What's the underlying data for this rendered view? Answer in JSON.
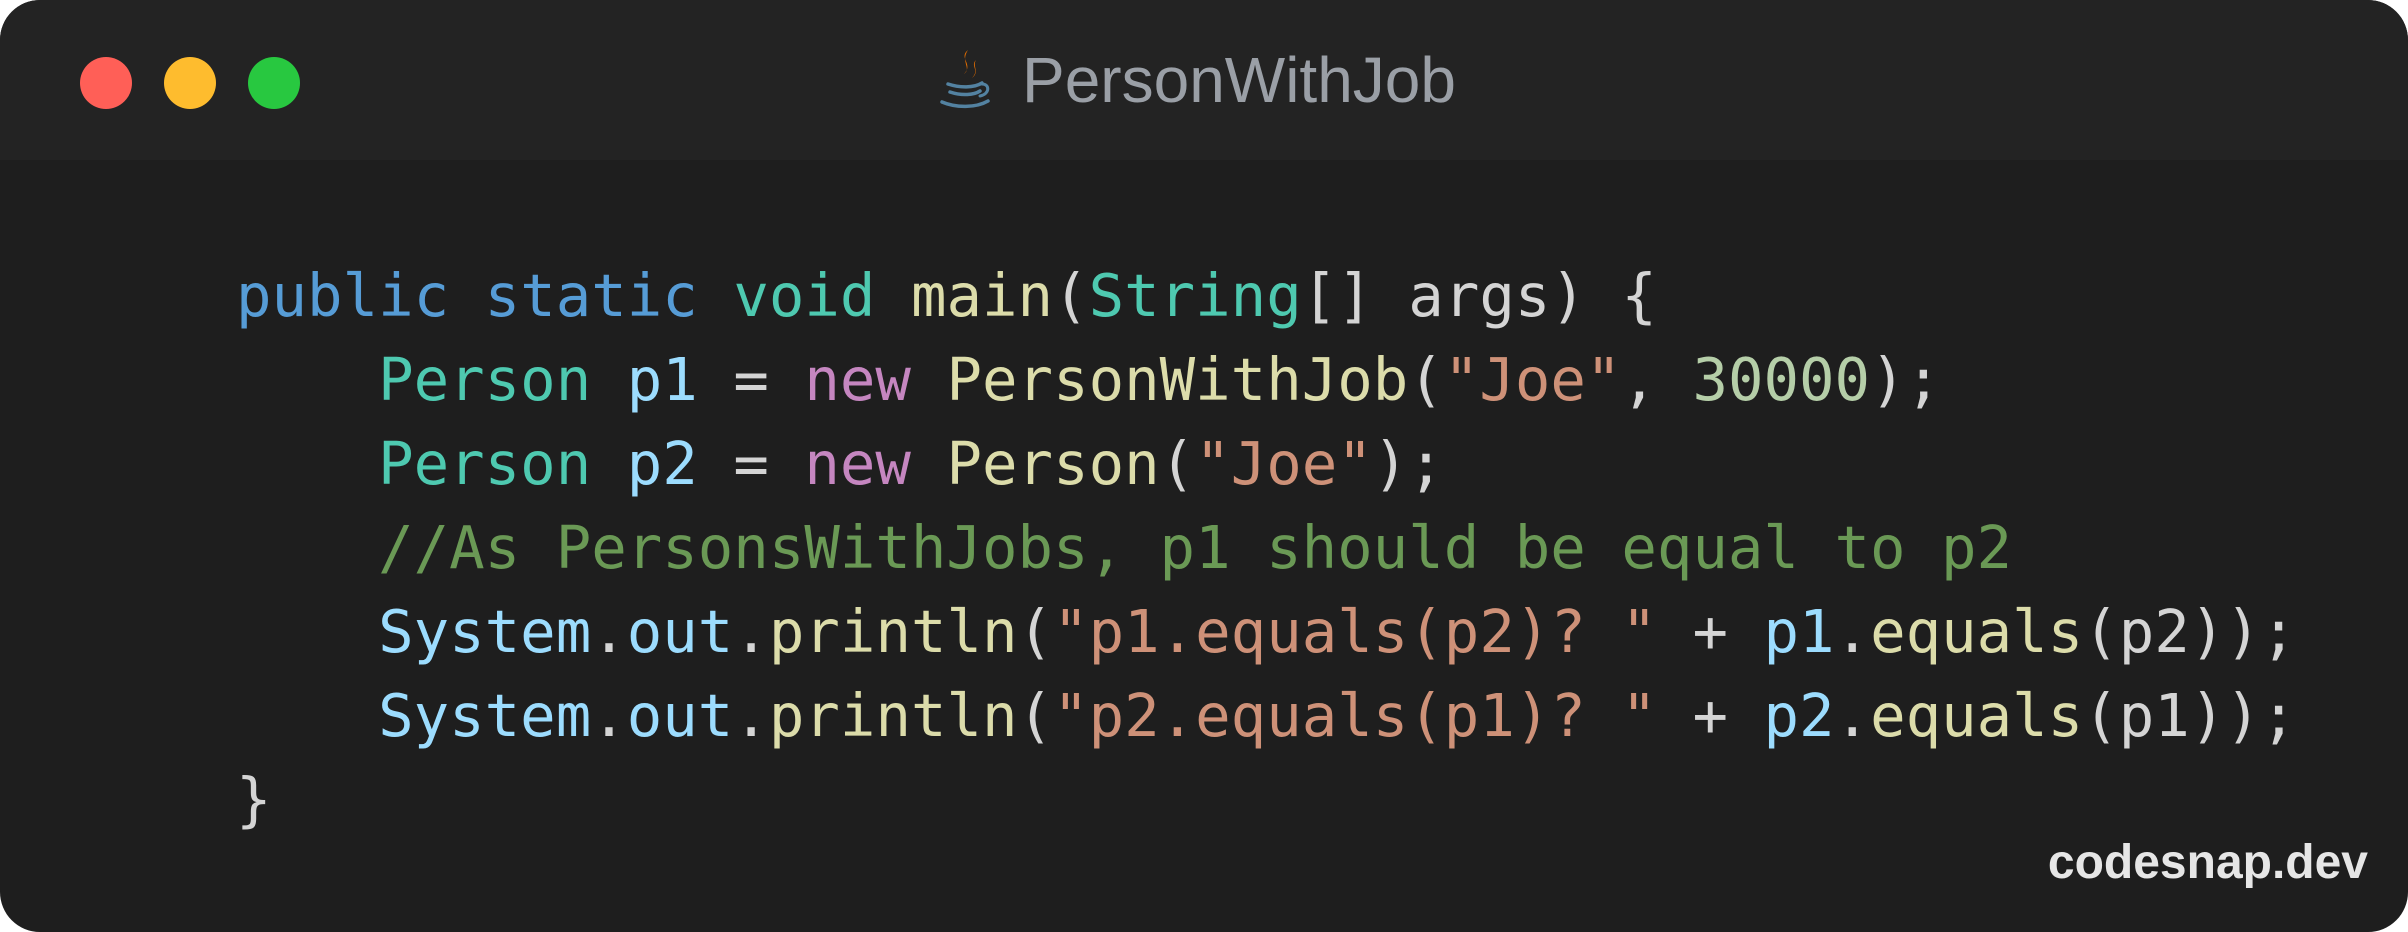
{
  "window": {
    "title": "PersonWithJob",
    "icon": "java-coffee-cup-icon",
    "controls": [
      {
        "name": "close-button",
        "color": "#ff5f57"
      },
      {
        "name": "minimize-button",
        "color": "#febc2e"
      },
      {
        "name": "zoom-button",
        "color": "#28c840"
      }
    ]
  },
  "code": {
    "language": "java",
    "lines": [
      [
        {
          "t": "public",
          "k": "keyword"
        },
        {
          "t": " ",
          "k": "plain"
        },
        {
          "t": "static",
          "k": "keyword"
        },
        {
          "t": " ",
          "k": "plain"
        },
        {
          "t": "void",
          "k": "type"
        },
        {
          "t": " ",
          "k": "plain"
        },
        {
          "t": "main",
          "k": "func"
        },
        {
          "t": "(",
          "k": "plain"
        },
        {
          "t": "String",
          "k": "type"
        },
        {
          "t": "[] args) {",
          "k": "plain"
        }
      ],
      [
        {
          "t": "    ",
          "k": "plain"
        },
        {
          "t": "Person",
          "k": "type"
        },
        {
          "t": " ",
          "k": "plain"
        },
        {
          "t": "p1",
          "k": "var"
        },
        {
          "t": " = ",
          "k": "plain"
        },
        {
          "t": "new",
          "k": "new"
        },
        {
          "t": " ",
          "k": "plain"
        },
        {
          "t": "PersonWithJob",
          "k": "func"
        },
        {
          "t": "(",
          "k": "plain"
        },
        {
          "t": "\"Joe\"",
          "k": "string"
        },
        {
          "t": ", ",
          "k": "plain"
        },
        {
          "t": "30000",
          "k": "number"
        },
        {
          "t": ");",
          "k": "plain"
        }
      ],
      [
        {
          "t": "    ",
          "k": "plain"
        },
        {
          "t": "Person",
          "k": "type"
        },
        {
          "t": " ",
          "k": "plain"
        },
        {
          "t": "p2",
          "k": "var"
        },
        {
          "t": " = ",
          "k": "plain"
        },
        {
          "t": "new",
          "k": "new"
        },
        {
          "t": " ",
          "k": "plain"
        },
        {
          "t": "Person",
          "k": "func"
        },
        {
          "t": "(",
          "k": "plain"
        },
        {
          "t": "\"Joe\"",
          "k": "string"
        },
        {
          "t": ");",
          "k": "plain"
        }
      ],
      [
        {
          "t": "    ",
          "k": "plain"
        },
        {
          "t": "//As PersonsWithJobs, p1 should be equal to p2",
          "k": "comment"
        }
      ],
      [
        {
          "t": "    ",
          "k": "plain"
        },
        {
          "t": "System",
          "k": "var"
        },
        {
          "t": ".",
          "k": "plain"
        },
        {
          "t": "out",
          "k": "var"
        },
        {
          "t": ".",
          "k": "plain"
        },
        {
          "t": "println",
          "k": "func"
        },
        {
          "t": "(",
          "k": "plain"
        },
        {
          "t": "\"p1.equals(p2)? \"",
          "k": "string"
        },
        {
          "t": " + ",
          "k": "plain"
        },
        {
          "t": "p1",
          "k": "var"
        },
        {
          "t": ".",
          "k": "plain"
        },
        {
          "t": "equals",
          "k": "func"
        },
        {
          "t": "(p2));",
          "k": "plain"
        }
      ],
      [
        {
          "t": "    ",
          "k": "plain"
        },
        {
          "t": "System",
          "k": "var"
        },
        {
          "t": ".",
          "k": "plain"
        },
        {
          "t": "out",
          "k": "var"
        },
        {
          "t": ".",
          "k": "plain"
        },
        {
          "t": "println",
          "k": "func"
        },
        {
          "t": "(",
          "k": "plain"
        },
        {
          "t": "\"p2.equals(p1)? \"",
          "k": "string"
        },
        {
          "t": " + ",
          "k": "plain"
        },
        {
          "t": "p2",
          "k": "var"
        },
        {
          "t": ".",
          "k": "plain"
        },
        {
          "t": "equals",
          "k": "func"
        },
        {
          "t": "(p1));",
          "k": "plain"
        }
      ],
      [
        {
          "t": "}",
          "k": "plain"
        }
      ]
    ]
  },
  "watermark": "codesnap.dev",
  "colors": {
    "background": "#1e1e1e",
    "titlebar": "#232323",
    "title_text": "#9a9fa6",
    "keyword": "#569cd6",
    "type": "#4ec9b0",
    "function": "#dcdcaa",
    "string": "#ce9178",
    "number": "#b5cea8",
    "comment": "#6a9955",
    "new_keyword": "#c586c0",
    "variable": "#9cdcfe",
    "plain": "#d4d4d4"
  }
}
